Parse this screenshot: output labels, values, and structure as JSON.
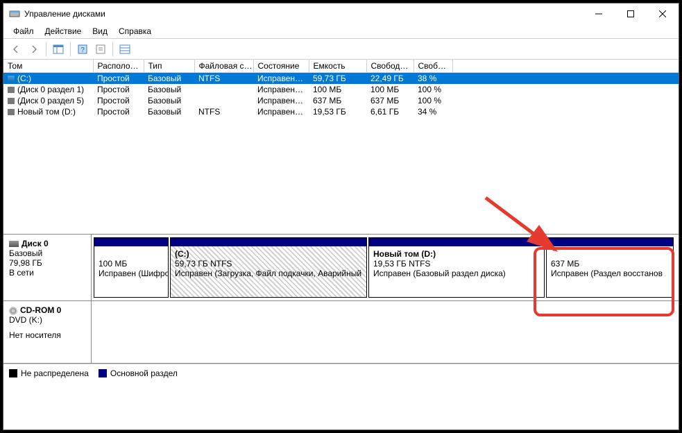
{
  "window": {
    "title": "Управление дисками"
  },
  "menu": {
    "file": "Файл",
    "action": "Действие",
    "view": "Вид",
    "help": "Справка"
  },
  "columns": {
    "volume": "Том",
    "layout": "Располо…",
    "type": "Тип",
    "filesystem": "Файловая с…",
    "status": "Состояние",
    "capacity": "Емкость",
    "free": "Свобод…",
    "freepct": "Своб…"
  },
  "volumes": [
    {
      "name": "(C:)",
      "icon": "blue",
      "selected": true,
      "layout": "Простой",
      "type": "Базовый",
      "fs": "NTFS",
      "status": "Исправен…",
      "capacity": "59,73 ГБ",
      "free": "22,49 ГБ",
      "freepct": "38 %"
    },
    {
      "name": "(Диск 0 раздел 1)",
      "icon": "gray",
      "layout": "Простой",
      "type": "Базовый",
      "fs": "",
      "status": "Исправен…",
      "capacity": "100 МБ",
      "free": "100 МБ",
      "freepct": "100 %"
    },
    {
      "name": "(Диск 0 раздел 5)",
      "icon": "gray",
      "layout": "Простой",
      "type": "Базовый",
      "fs": "",
      "status": "Исправен…",
      "capacity": "637 МБ",
      "free": "637 МБ",
      "freepct": "100 %"
    },
    {
      "name": "Новый том (D:)",
      "icon": "gray",
      "layout": "Простой",
      "type": "Базовый",
      "fs": "NTFS",
      "status": "Исправен…",
      "capacity": "19,53 ГБ",
      "free": "6,61 ГБ",
      "freepct": "34 %"
    }
  ],
  "disk0": {
    "label": "Диск 0",
    "type": "Базовый",
    "size": "79,98 ГБ",
    "status": "В сети",
    "parts": [
      {
        "title": "",
        "line2": "100 МБ",
        "line3": "Исправен (Шифро",
        "hatched": false
      },
      {
        "title": "(C:)",
        "line2": "59,73 ГБ NTFS",
        "line3": "Исправен (Загрузка, Файл подкачки, Аварийный",
        "hatched": true
      },
      {
        "title": "Новый том  (D:)",
        "line2": "19,53 ГБ NTFS",
        "line3": "Исправен (Базовый раздел диска)",
        "hatched": false
      },
      {
        "title": "",
        "line2": "637 МБ",
        "line3": "Исправен (Раздел восстанов",
        "hatched": false
      }
    ]
  },
  "cdrom": {
    "label": "CD-ROM 0",
    "sub": "DVD (K:)",
    "status": "Нет носителя"
  },
  "legend": {
    "unallocated": "Не распределена",
    "primary": "Основной раздел"
  }
}
